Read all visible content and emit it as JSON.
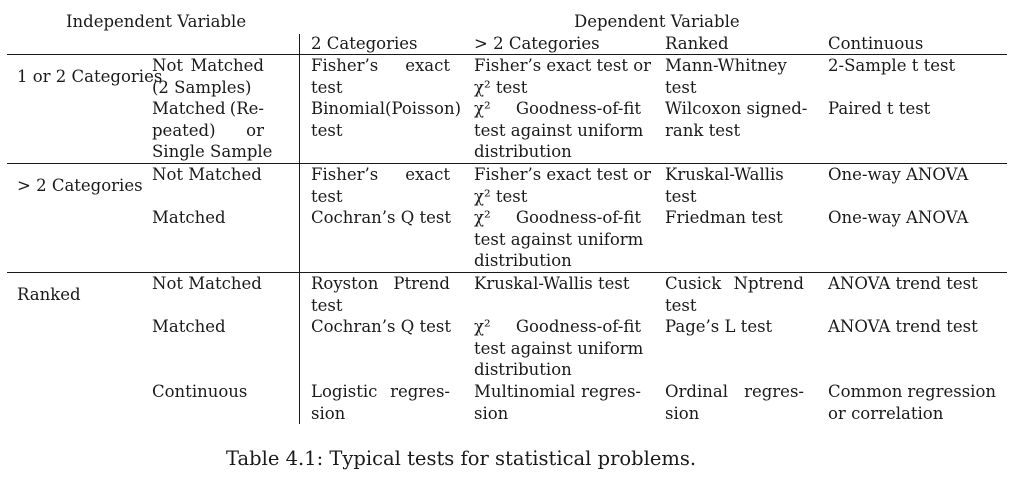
{
  "header": {
    "independent_variable": "Independent Variable",
    "dependent_variable": "Dependent Variable",
    "col_2cat": "2 Categories",
    "col_gt2cat": "> 2 Categories",
    "col_ranked": "Ranked",
    "col_continuous": "Continuous"
  },
  "groups": [
    {
      "label": "1 or 2 Categories",
      "rows": [
        {
          "sub_a": "Not",
          "sub_b": "Matched",
          "sub_line2": "(2 Samples)",
          "c1_a": "Fisher’s",
          "c1_b": "exact",
          "c1_line2": "test",
          "c2_line1": "Fisher’s exact test or",
          "c2_line2": "χ² test",
          "c3_line1": "Mann-Whitney",
          "c3_line2": "test",
          "c4": "2-Sample t test"
        },
        {
          "sub_a": "Matched",
          "sub_b": "(Re-",
          "sub_line2_a": "peated)",
          "sub_line2_b": "or",
          "sub_line3": "Single Sample",
          "c1_line1": "Binomial(Poisson)",
          "c1_line2": "test",
          "c2_a": "χ²",
          "c2_b": "Goodness-of-fit",
          "c2_line2": "test against uniform",
          "c2_line3": "distribution",
          "c3_line1": "Wilcoxon signed-",
          "c3_line2": "rank test",
          "c4": "Paired t test"
        }
      ]
    },
    {
      "label": "> 2 Categories",
      "rows": [
        {
          "sub": "Not Matched",
          "c1_a": "Fisher’s",
          "c1_b": "exact",
          "c1_line2": "test",
          "c2_line1": "Fisher’s exact test or",
          "c2_line2": "χ² test",
          "c3_line1": "Kruskal-Wallis",
          "c3_line2": "test",
          "c4": "One-way ANOVA"
        },
        {
          "sub": "Matched",
          "c1": "Cochran’s Q test",
          "c2_a": "χ²",
          "c2_b": "Goodness-of-fit",
          "c2_line2": "test against uniform",
          "c2_line3": "distribution",
          "c3": "Friedman test",
          "c4": "One-way ANOVA"
        }
      ]
    },
    {
      "label": "Ranked",
      "rows": [
        {
          "sub": "Not Matched",
          "c1_a": "Royston",
          "c1_b": "Ptrend",
          "c1_line2": "test",
          "c2": "Kruskal-Wallis test",
          "c3_a": "Cusick",
          "c3_b": "Nptrend",
          "c3_line2": "test",
          "c4": "ANOVA trend test"
        },
        {
          "sub": "Matched",
          "c1": "Cochran’s Q test",
          "c2_a": "χ²",
          "c2_b": "Goodness-of-fit",
          "c2_line2": "test against uniform",
          "c2_line3": "distribution",
          "c3": "Page’s L test",
          "c4": "ANOVA trend test"
        },
        {
          "sub": "Continuous",
          "c1_a": "Logistic",
          "c1_b": "regres-",
          "c1_line2": "sion",
          "c2_a": "Multinomial",
          "c2_b": "regres-",
          "c2_line2": "sion",
          "c3_a": "Ordinal",
          "c3_b": "regres-",
          "c3_line2": "sion",
          "c4_a": "Common",
          "c4_b": "regression",
          "c4_line2": "or correlation"
        }
      ]
    }
  ],
  "caption": "Table 4.1: Typical tests for statistical problems."
}
